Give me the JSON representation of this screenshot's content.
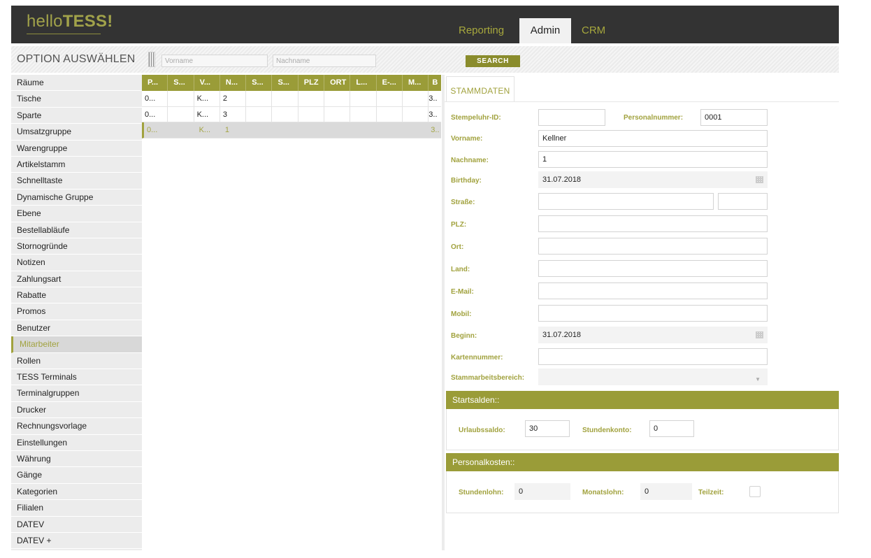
{
  "app": {
    "logo_light": "hello",
    "logo_bold": "TESS!"
  },
  "nav": {
    "tabs": [
      {
        "label": "Reporting",
        "active": false
      },
      {
        "label": "Admin",
        "active": true
      },
      {
        "label": "CRM",
        "active": false
      }
    ]
  },
  "toolbar": {
    "title": "OPTION AUSWÄHLEN",
    "first_name_placeholder": "Vorname",
    "last_name_placeholder": "Nachname",
    "search_label": "SEARCH"
  },
  "sidebar": {
    "active_item": "Mitarbeiter",
    "items": [
      "Räume",
      "Tische",
      "Sparte",
      "Umsatzgruppe",
      "Warengruppe",
      "Artikelstamm",
      "Schnelltaste",
      "Dynamische Gruppe",
      "Ebene",
      "Bestellabläufe",
      "Stornogründe",
      "Notizen",
      "Zahlungsart",
      "Rabatte",
      "Promos",
      "Benutzer",
      "Mitarbeiter",
      "Rollen",
      "TESS Terminals",
      "Terminalgruppen",
      "Drucker",
      "Rechnungsvorlage",
      "Einstellungen",
      "Währung",
      "Gänge",
      "Kategorien",
      "Filialen",
      "DATEV",
      "DATEV +"
    ]
  },
  "grid": {
    "columns": [
      "P...",
      "S...",
      "V...",
      "N...",
      "S...",
      "S...",
      "PLZ",
      "ORT",
      "L...",
      "E-...",
      "M...",
      "B"
    ],
    "rows": [
      [
        "0...",
        "",
        "K...",
        "2",
        "",
        "",
        "",
        "",
        "",
        "",
        "",
        "3.."
      ],
      [
        "0...",
        "",
        "K...",
        "3",
        "",
        "",
        "",
        "",
        "",
        "",
        "",
        "3.."
      ],
      [
        "0...",
        "",
        "K...",
        "1",
        "",
        "",
        "",
        "",
        "",
        "",
        "",
        "3.."
      ]
    ],
    "selected_row": 2
  },
  "detail": {
    "tab_label": "STAMMDATEN",
    "fields": {
      "stempeluhr_label": "Stempeluhr-ID:",
      "stempeluhr_value": "",
      "personalnummer_label": "Personalnummer:",
      "personalnummer_value": "0001",
      "vorname_label": "Vorname:",
      "vorname_value": "Kellner",
      "nachname_label": "Nachname:",
      "nachname_value": "1",
      "birthday_label": "Birthday:",
      "birthday_value": "31.07.2018",
      "strasse_label": "Straße:",
      "plz_label": "PLZ:",
      "ort_label": "Ort:",
      "land_label": "Land:",
      "email_label": "E-Mail:",
      "mobil_label": "Mobil:",
      "beginn_label": "Beginn:",
      "beginn_value": "31.07.2018",
      "kartennummer_label": "Kartennummer:",
      "stammarbeitsbereich_label": "Stammarbeitsbereich:"
    },
    "startsalden": {
      "title": "Startsalden::",
      "urlaubssaldo_label": "Urlaubssaldo:",
      "urlaubssaldo_value": "30",
      "stundenkonto_label": "Stundenkonto:",
      "stundenkonto_value": "0"
    },
    "personalkosten": {
      "title": "Personalkosten::",
      "stundenlohn_label": "Stundenlohn:",
      "stundenlohn_value": "0",
      "monatslohn_label": "Monatslohn:",
      "monatslohn_value": "0",
      "teilzeit_label": "Teilzeit:",
      "teilzeit_checked": false
    }
  },
  "colors": {
    "accent": "#9a9c38",
    "accent_text": "#a1a23e",
    "topbar": "#333333"
  }
}
